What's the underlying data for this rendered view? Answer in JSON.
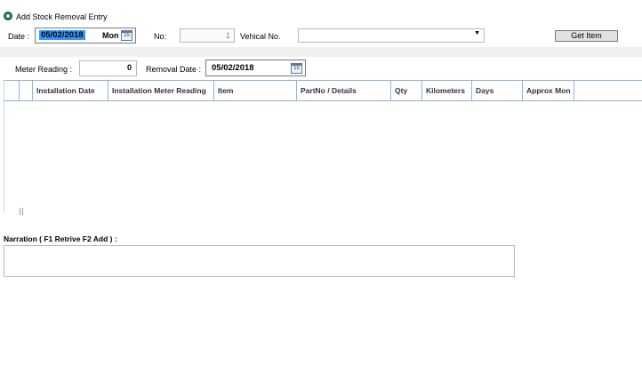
{
  "window": {
    "title": "Add Stock Removal Entry"
  },
  "form": {
    "date_label": "Date :",
    "date_value": "05/02/2018",
    "day_value": "Mon",
    "calendar_icon_text": "15",
    "no_label": "No:",
    "no_value": "1",
    "vehicle_label": "Vehical No.",
    "vehicle_value": "",
    "get_item_label": "Get Item",
    "meter_label": "Meter Reading :",
    "meter_value": "0",
    "removal_label": "Removal Date :",
    "removal_value": "05/02/2018"
  },
  "grid": {
    "columns": [
      "Installation Date",
      "Installation Meter Reading",
      "Item",
      "PartNo / Details",
      "Qty",
      "Kilometers",
      "Days",
      "Approx Mon"
    ],
    "rows": []
  },
  "narration": {
    "label": "Narration ( F1 Retrive F2 Add ) :",
    "value": ""
  },
  "colors": {
    "selection": "#3399ff",
    "grid_line": "#8fb3d9",
    "icon": "#1f6b3a"
  },
  "icons": [
    "app-icon",
    "calendar-icon",
    "dropdown-arrow-icon"
  ]
}
